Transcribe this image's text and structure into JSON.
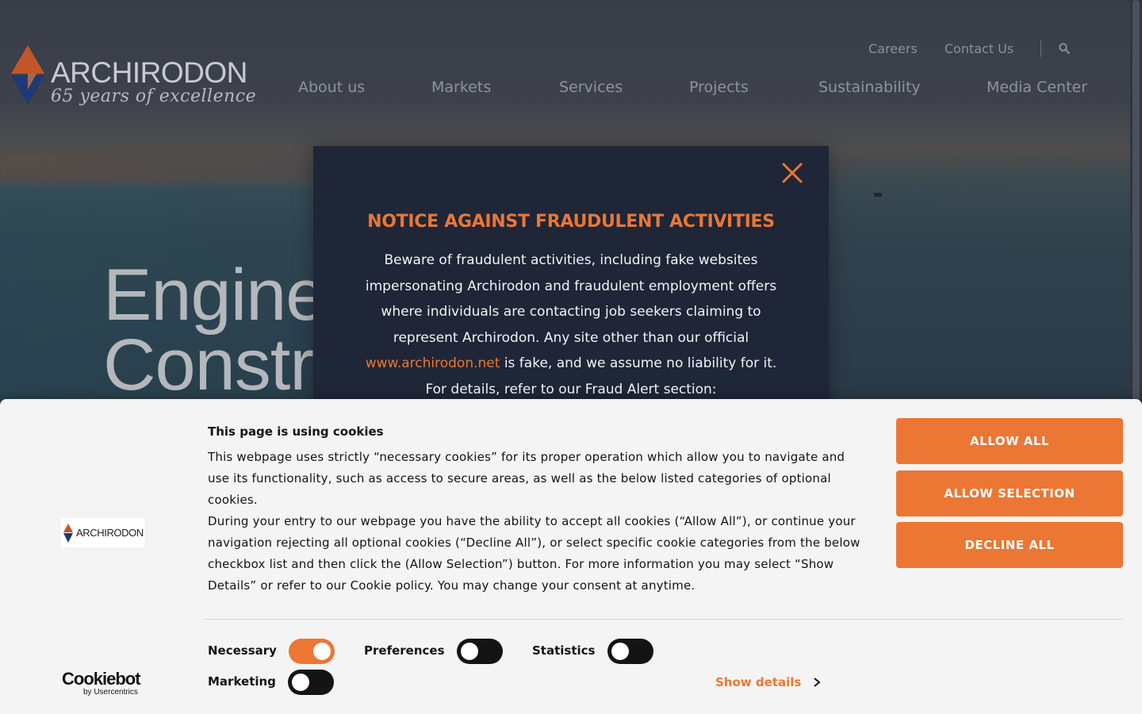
{
  "header": {
    "logo": {
      "wordmark": "ARCHIRODON",
      "tagline": "65 years of excellence"
    },
    "util_nav": [
      "Careers",
      "Contact Us"
    ],
    "main_nav": [
      "About us",
      "Markets",
      "Services",
      "Projects",
      "Sustainability",
      "Media Center"
    ]
  },
  "hero": {
    "line1": "Engineering &",
    "line2": "Construction"
  },
  "fraud_notice": {
    "title": "NOTICE AGAINST FRAUDULENT ACTIVITIES",
    "body_before_link": "Beware of fraudulent activities, including fake websites impersonating Archirodon and fraudulent employment offers where individuals are contacting job seekers claiming to represent Archirodon. Any site other than our official",
    "link_text": "www.archirodon.net",
    "body_after_link": "is fake, and we assume no liability for it. For details, refer to our Fraud Alert section:"
  },
  "cookie_banner": {
    "logo_word": "ARCHIRODON",
    "brand": "Cookiebot",
    "brand_sub": "by Usercentrics",
    "heading": "This page is using cookies",
    "paragraph1": "This webpage uses strictly “necessary cookies” for its proper operation which allow you to navigate and use its functionality, such as access to secure areas, as well as the below listed categories of optional cookies.",
    "paragraph2": "During your entry to our webpage you have the ability to accept all cookies (“Allow All”), or continue your navigation rejecting all optional cookies (“Decline All”), or select specific cookie categories from the below checkbox list and then click the (Allow Selection”) button. For more information you may select “Show Details” or refer to our Cookie policy. You may change your consent at anytime.",
    "buttons": {
      "allow_all": "ALLOW ALL",
      "allow_selection": "ALLOW SELECTION",
      "decline_all": "DECLINE ALL"
    },
    "toggles": {
      "necessary": {
        "label": "Necessary",
        "on": true
      },
      "preferences": {
        "label": "Preferences",
        "on": false
      },
      "statistics": {
        "label": "Statistics",
        "on": false
      },
      "marketing": {
        "label": "Marketing",
        "on": false
      }
    },
    "show_details": "Show details"
  },
  "colors": {
    "accent": "#ec7633",
    "modal_bg": "#1e2637",
    "banner_bg": "#f4f4f4",
    "text_dark": "#141414"
  }
}
